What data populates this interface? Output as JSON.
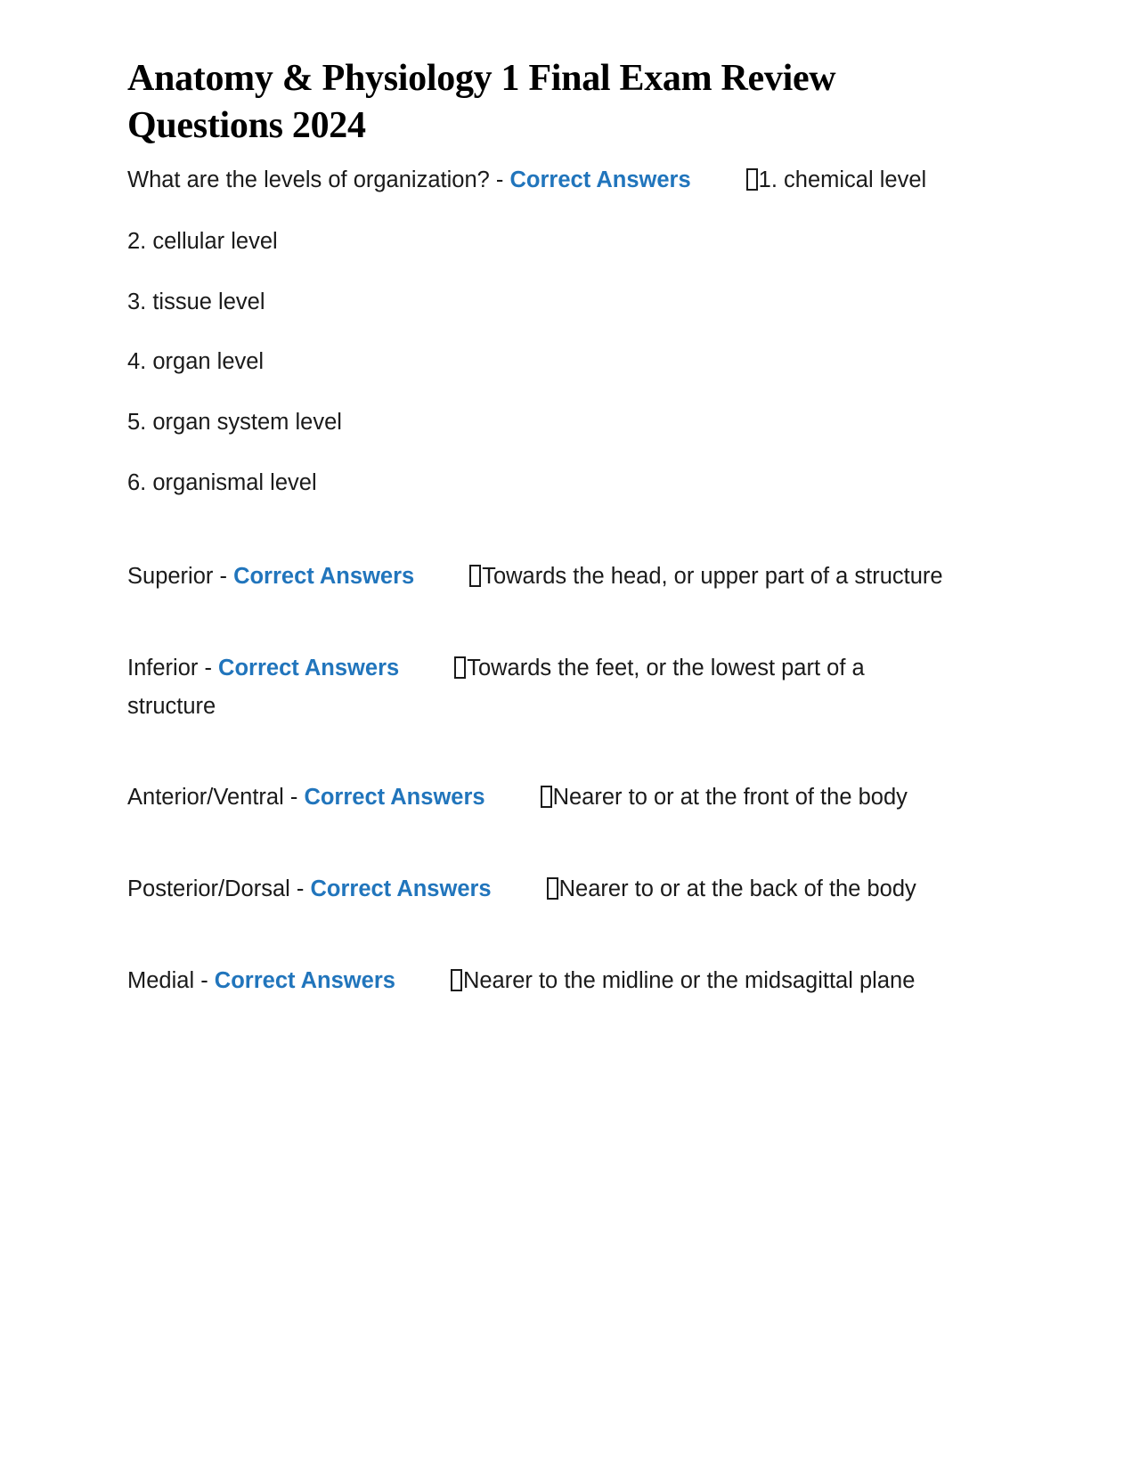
{
  "document": {
    "title": "Anatomy & Physiology 1 Final Exam Review Questions 2024",
    "answer_marker_label": "Correct Answers",
    "separator": " - ",
    "missing_glyph_name": "tofu-box-glyph",
    "accent_color": "#2175BC",
    "text_color": "#1a1a1a",
    "background_color": "#ffffff"
  },
  "entries": [
    {
      "id": "levels-of-organization",
      "prompt": "What are the levels of organization?",
      "answer_first_line": "1.",
      "answer_continuation": "chemical level",
      "list": [
        "2. cellular level",
        "3. tissue level",
        "4. organ level",
        "5. organ system level",
        "6. organismal level"
      ]
    },
    {
      "id": "superior",
      "prompt": "Superior",
      "answer": "Towards the head, or upper part of a structure"
    },
    {
      "id": "inferior",
      "prompt": "Inferior",
      "answer": "Towards the feet, or the lowest part of a structure"
    },
    {
      "id": "anterior-ventral",
      "prompt": "Anterior/Ventral",
      "answer": "Nearer to or at the front of the body"
    },
    {
      "id": "posterior-dorsal",
      "prompt": "Posterior/Dorsal",
      "answer": "Nearer to or at the back of the body"
    },
    {
      "id": "medial",
      "prompt": "Medial",
      "answer": "Nearer to the midline or the midsagittal plane"
    }
  ]
}
